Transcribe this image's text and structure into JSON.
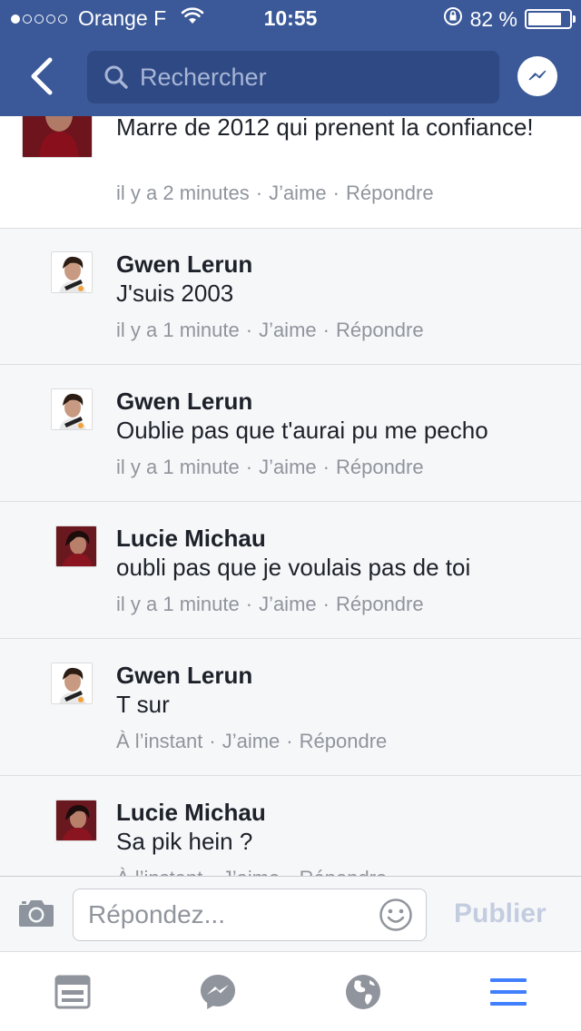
{
  "status_bar": {
    "carrier": "Orange F",
    "time": "10:55",
    "battery_percent": "82 %",
    "battery_level": 0.82,
    "signal_bars_filled": 1,
    "signal_bars_total": 5
  },
  "header": {
    "search_placeholder": "Rechercher",
    "background_color": "#3b5998"
  },
  "comments": [
    {
      "author": "",
      "text": "Marre de 2012 qui prenent la confiance!",
      "time": "il y a 2 minutes",
      "like": "J’aime",
      "reply": "Répondre"
    },
    {
      "author": "Gwen Lerun",
      "text": "J'suis 2003",
      "time": "il y a 1 minute",
      "like": "J’aime",
      "reply": "Répondre"
    },
    {
      "author": "Gwen Lerun",
      "text": "Oublie pas que t'aurai pu me pecho",
      "time": "il y a 1 minute",
      "like": "J’aime",
      "reply": "Répondre"
    },
    {
      "author": "Lucie Michau",
      "text": "oubli pas que je voulais pas de toi",
      "time": "il y a 1 minute",
      "like": "J’aime",
      "reply": "Répondre"
    },
    {
      "author": "Gwen Lerun",
      "text": "T sur",
      "time": "À l’instant",
      "like": "J’aime",
      "reply": "Répondre"
    },
    {
      "author": "Lucie Michau",
      "text": "Sa pik hein ?",
      "time": "À l’instant",
      "like": "J’aime",
      "reply": "Répondre"
    }
  ],
  "composer": {
    "placeholder": "Répondez...",
    "publish_label": "Publier"
  },
  "tab_bar": {
    "items": [
      "news-feed-icon",
      "messenger-icon",
      "globe-icon",
      "menu-icon"
    ],
    "active_color": "#4080ff",
    "inactive_color": "#90949c"
  }
}
